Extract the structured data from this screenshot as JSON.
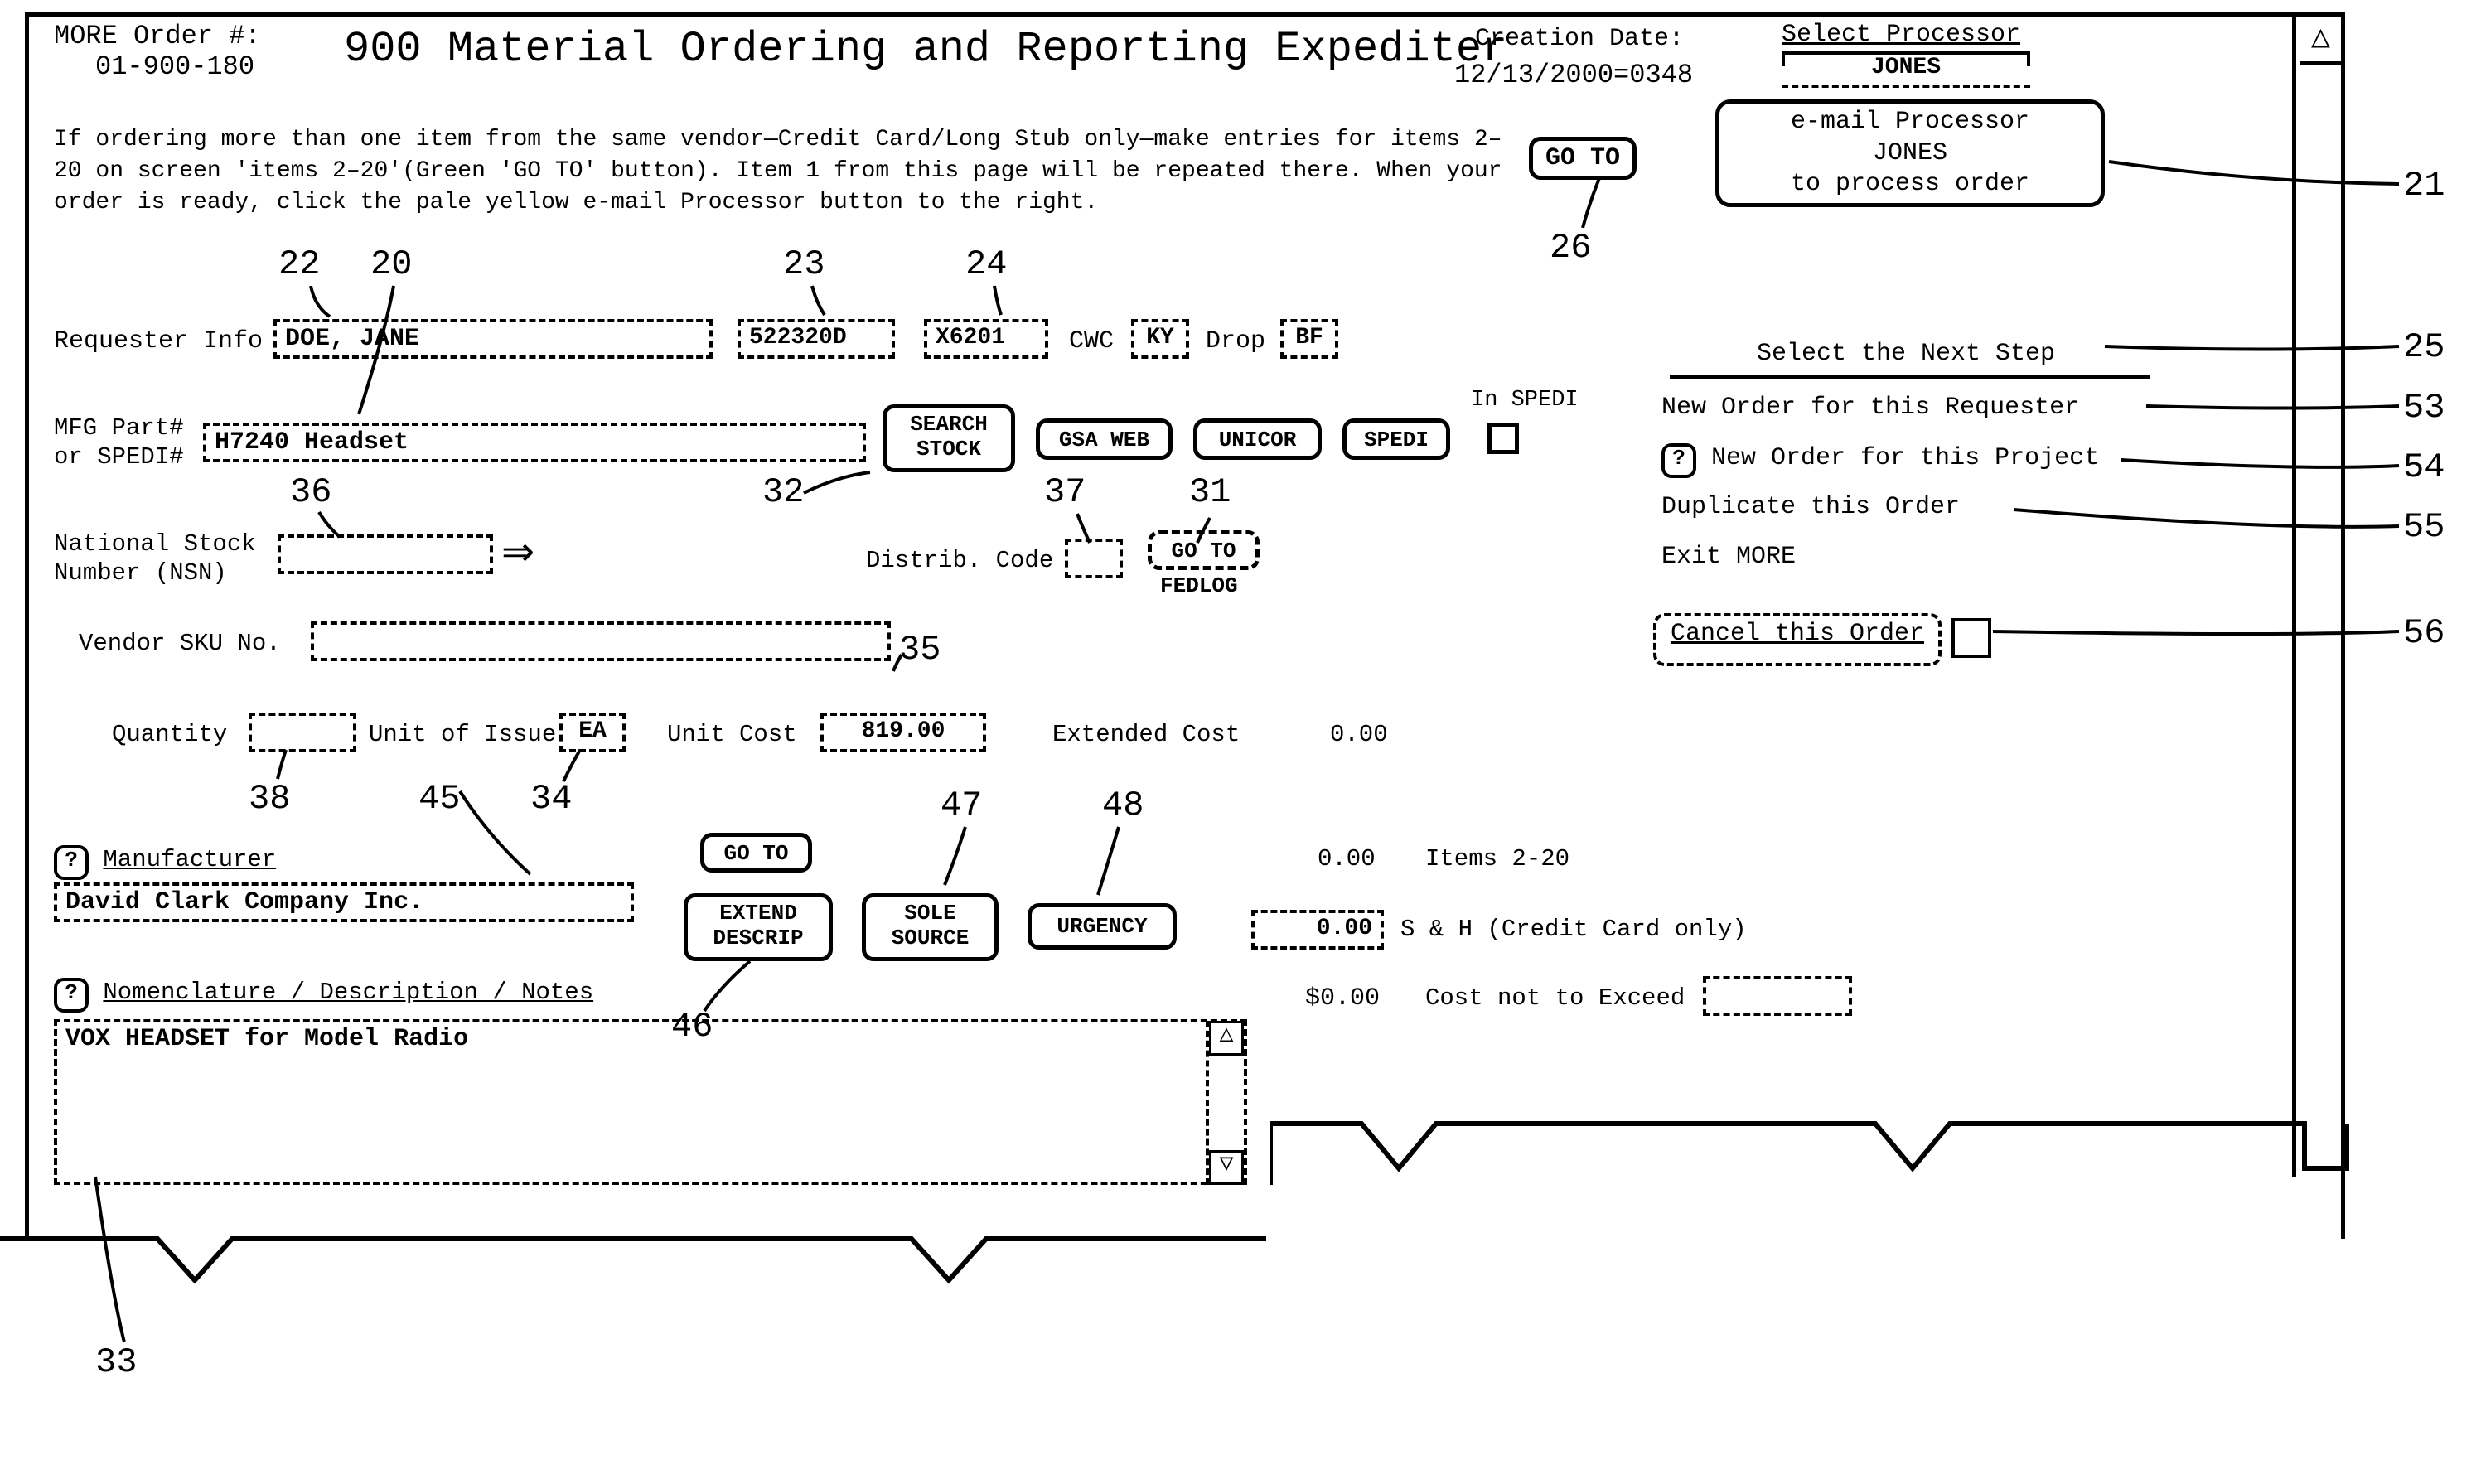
{
  "header": {
    "order_label": "MORE Order #:",
    "order_number": "01-900-180",
    "title": "900 Material Ordering and Reporting Expediter",
    "creation_label": "Creation Date:",
    "creation_value": "12/13/2000=0348"
  },
  "instructions": "If ordering more than one item from the same vendor—Credit Card/Long Stub only—make entries for items 2–20 on screen 'items 2–20'(Green 'GO TO' button). Item 1 from this page will be repeated there. When your order is ready, click the pale yellow e-mail Processor button to the right.",
  "go_to_main": "GO TO",
  "processor": {
    "select_label": "Select Processor",
    "name": "JONES",
    "email_line1": "e-mail Processor",
    "email_line2": "JONES",
    "email_line3": "to process order"
  },
  "next_step": {
    "header": "Select the Next Step",
    "new_requester": "New Order for this Requester",
    "new_project": "New Order for this Project",
    "duplicate": "Duplicate this Order",
    "exit": "Exit MORE",
    "cancel": "Cancel this Order"
  },
  "fields": {
    "requester_label": "Requester Info",
    "requester_name": "DOE, JANE",
    "org_code": "522320D",
    "proj_code": "X6201",
    "cwc_label": "CWC",
    "cwc_value": "KY",
    "drop_label": "Drop",
    "drop_value": "BF",
    "mfg_label1": "MFG Part#",
    "mfg_label2": "or SPEDI#",
    "mfg_value": "H7240 Headset",
    "search_stock_1": "SEARCH",
    "search_stock_2": "STOCK",
    "gsa_web": "GSA WEB",
    "unicor": "UNICOR",
    "spedi_btn": "SPEDI",
    "in_spedi": "In SPEDI",
    "nsn_label1": "National Stock",
    "nsn_label2": "Number (NSN)",
    "nsn_value": "",
    "distrib_label": "Distrib. Code",
    "distrib_value": "",
    "go_to_fedlog": "GO TO",
    "fedlog": "FEDLOG",
    "vendor_sku_label": "Vendor SKU No.",
    "vendor_sku_value": "",
    "qty_label": "Quantity",
    "qty_value": "",
    "uoi_label": "Unit of Issue",
    "uoi_value": "EA",
    "unit_cost_label": "Unit Cost",
    "unit_cost_value": "819.00",
    "ext_cost_label": "Extended Cost",
    "ext_cost_value": "0.00",
    "mfr_label": "Manufacturer",
    "mfr_value": "David Clark Company Inc.",
    "goto2": "GO TO",
    "extend1": "EXTEND",
    "extend2": "DESCRIP",
    "sole1": "SOLE",
    "sole2": "SOURCE",
    "urgency": "URGENCY",
    "items_amount": "0.00",
    "items_label": "Items 2-20",
    "sh_value": "0.00",
    "sh_label": "S & H (Credit Card only)",
    "total_label": "$0.00",
    "cne_label": "Cost not to Exceed",
    "cne_value": "",
    "desc_hdr": "Nomenclature / Description / Notes",
    "desc_value": "VOX HEADSET for Model Radio"
  },
  "callouts": {
    "c20": "20",
    "c21": "21",
    "c22": "22",
    "c23": "23",
    "c24": "24",
    "c25": "25",
    "c26": "26",
    "c31": "31",
    "c32": "32",
    "c33": "33",
    "c34": "34",
    "c35": "35",
    "c36": "36",
    "c37": "37",
    "c38": "38",
    "c45": "45",
    "c46": "46",
    "c47": "47",
    "c48": "48",
    "c53": "53",
    "c54": "54",
    "c55": "55",
    "c56": "56"
  }
}
